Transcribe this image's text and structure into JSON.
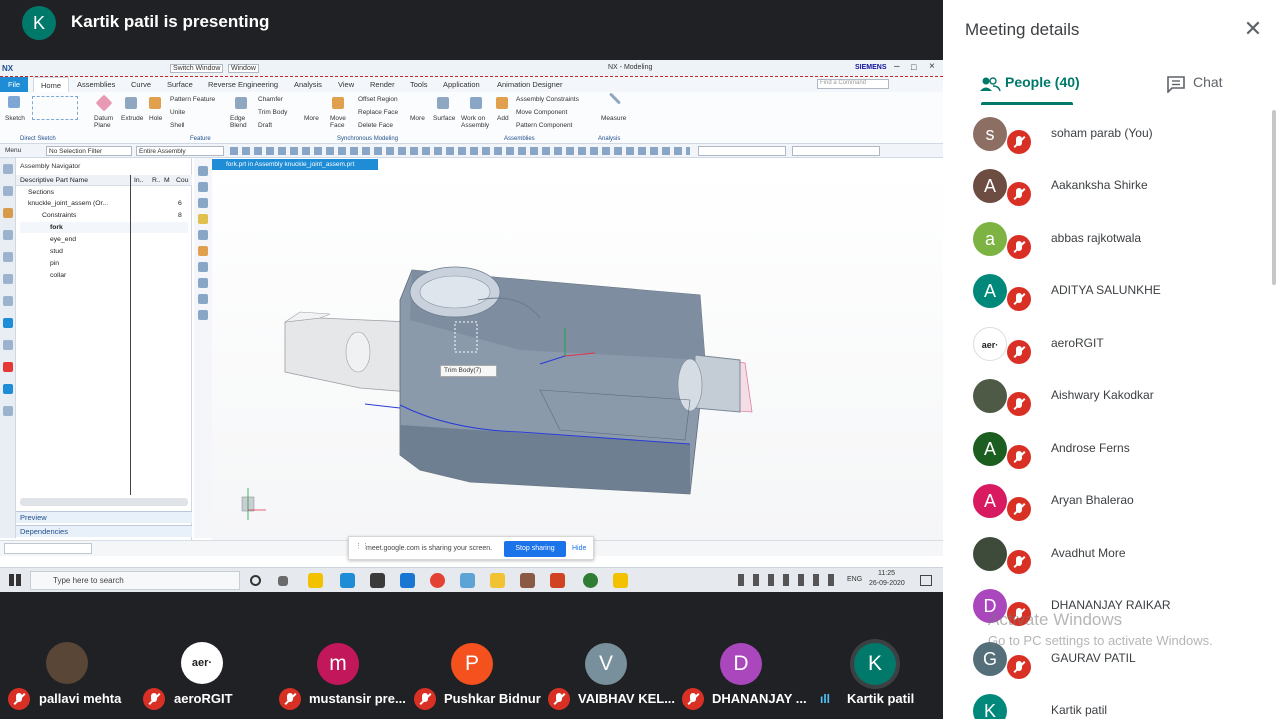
{
  "top": {
    "presenter_initial": "K",
    "presenting_text": "Kartik patil is presenting"
  },
  "nx": {
    "logo": "NX",
    "title": "NX - Modeling",
    "brand": "SIEMENS",
    "switch_window": "Switch Window",
    "window": "Window",
    "find_command": "Find a Command",
    "tabs": [
      "File",
      "Home",
      "Assemblies",
      "Curve",
      "Surface",
      "Reverse Engineering",
      "Analysis",
      "View",
      "Render",
      "Tools",
      "Application",
      "Animation Designer"
    ],
    "ribbon_items": {
      "sketch": "Sketch",
      "datum_plane": "Datum Plane",
      "extrude": "Extrude",
      "hole": "Hole",
      "pattern_feature": "Pattern Feature",
      "unite": "Unite",
      "shell": "Shell",
      "edge_blend": "Edge Blend",
      "chamfer": "Chamfer",
      "trim_body": "Trim Body",
      "draft": "Draft",
      "more": "More",
      "move_face": "Move Face",
      "offset_region": "Offset Region",
      "replace_face": "Replace Face",
      "delete_face": "Delete Face",
      "surface": "Surface",
      "work_on_assembly": "Work on Assembly",
      "add": "Add",
      "assembly_constraints": "Assembly Constraints",
      "move_component": "Move Component",
      "pattern_component": "Pattern Component",
      "measure": "Measure"
    },
    "groups": {
      "direct_sketch": "Direct Sketch",
      "feature": "Feature",
      "synchronous": "Synchronous Modeling",
      "assemblies": "Assemblies",
      "analysis": "Analysis"
    },
    "filter": {
      "menu": "Menu",
      "selection_filter": "No Selection Filter",
      "scope": "Entire Assembly"
    },
    "navigator": {
      "title": "Assembly Navigator",
      "col_name": "Descriptive Part Name",
      "col_in": "In..",
      "col_r": "R..",
      "col_m": "M",
      "col_cou": "Cou",
      "rows": [
        {
          "label": "Sections",
          "count": ""
        },
        {
          "label": "knuckle_joint_assem (Or...",
          "count": "6"
        },
        {
          "label": "Constraints",
          "count": "8"
        },
        {
          "label": "fork",
          "count": ""
        },
        {
          "label": "eye_end",
          "count": ""
        },
        {
          "label": "stud",
          "count": ""
        },
        {
          "label": "pin",
          "count": ""
        },
        {
          "label": "collar",
          "count": ""
        }
      ],
      "preview": "Preview",
      "dependencies": "Dependencies"
    },
    "doc_tab": "fork.prt in Assembly knuckle_joint_assem.prt",
    "trim_label": "Trim Body(7)"
  },
  "share": {
    "text": "meet.google.com is sharing your screen.",
    "stop": "Stop sharing",
    "hide": "Hide"
  },
  "taskbar": {
    "search_placeholder": "Type here to search",
    "lang": "ENG",
    "time": "11:25",
    "date": "26-09-2020"
  },
  "tiles": [
    {
      "name": "pallavi mehta",
      "initial": "",
      "color": "#5a4636"
    },
    {
      "name": "aeroRGIT",
      "initial": "",
      "color": "#ffffff"
    },
    {
      "name": "mustansir pre...",
      "initial": "m",
      "color": "#c2185b"
    },
    {
      "name": "Pushkar Bidnur",
      "initial": "P",
      "color": "#f4511e"
    },
    {
      "name": "VAIBHAV KEL...",
      "initial": "V",
      "color": "#78909c"
    },
    {
      "name": "DHANANJAY ...",
      "initial": "D",
      "color": "#ab47bc"
    },
    {
      "name": "Kartik patil",
      "initial": "K",
      "color": "#00796b"
    }
  ],
  "panel": {
    "title": "Meeting details",
    "people_tab": "People (40)",
    "chat_tab": "Chat",
    "people": [
      {
        "name": "soham parab (You)",
        "initial": "s",
        "color": "#8d6e63"
      },
      {
        "name": "Aakanksha Shirke",
        "initial": "A",
        "color": "#6d4c41"
      },
      {
        "name": "abbas rajkotwala",
        "initial": "a",
        "color": "#7cb342"
      },
      {
        "name": "ADITYA SALUNKHE",
        "initial": "A",
        "color": "#00897b"
      },
      {
        "name": "aeroRGIT",
        "initial": "",
        "color": "#ffffff"
      },
      {
        "name": "Aishwary Kakodkar",
        "initial": "",
        "color": "#4e5a46"
      },
      {
        "name": "Androse Ferns",
        "initial": "A",
        "color": "#1b5e20"
      },
      {
        "name": "Aryan Bhalerao",
        "initial": "A",
        "color": "#d81b60"
      },
      {
        "name": "Avadhut More",
        "initial": "",
        "color": "#3e4a3a"
      },
      {
        "name": "DHANANJAY RAIKAR",
        "initial": "D",
        "color": "#ab47bc"
      },
      {
        "name": "GAURAV PATIL",
        "initial": "G",
        "color": "#546e7a"
      },
      {
        "name": "Kartik patil",
        "initial": "K",
        "color": "#00897b"
      }
    ],
    "watermark_title": "Activate Windows",
    "watermark_sub": "Go to PC settings to activate Windows."
  }
}
